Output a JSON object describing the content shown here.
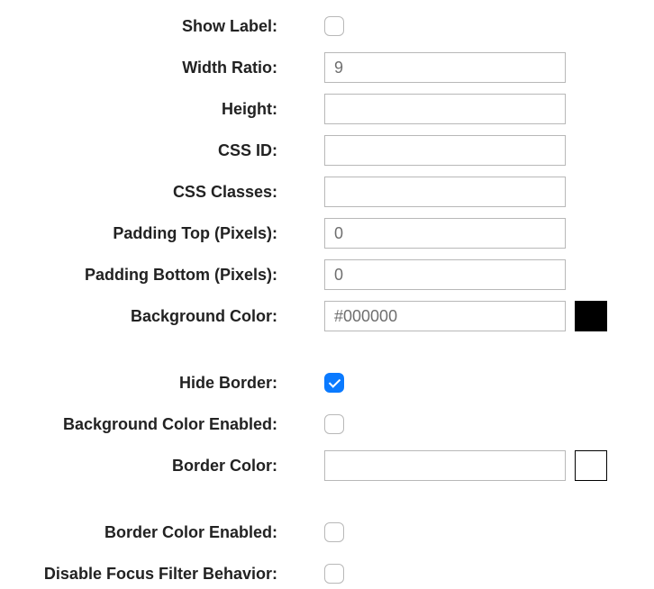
{
  "fields": {
    "show_label": {
      "label": "Show Label:",
      "checked": false
    },
    "width_ratio": {
      "label": "Width Ratio:",
      "value": "9"
    },
    "height": {
      "label": "Height:",
      "value": ""
    },
    "css_id": {
      "label": "CSS ID:",
      "value": ""
    },
    "css_classes": {
      "label": "CSS Classes:",
      "value": ""
    },
    "padding_top": {
      "label": "Padding Top (Pixels):",
      "value": "0"
    },
    "padding_bottom": {
      "label": "Padding Bottom (Pixels):",
      "value": "0"
    },
    "background_color": {
      "label": "Background Color:",
      "value": "#000000",
      "swatch": "#000000"
    },
    "hide_border": {
      "label": "Hide Border:",
      "checked": true
    },
    "background_color_enabled": {
      "label": "Background Color Enabled:",
      "checked": false
    },
    "border_color": {
      "label": "Border Color:",
      "value": "",
      "swatch": "#ffffff"
    },
    "border_color_enabled": {
      "label": "Border Color Enabled:",
      "checked": false
    },
    "disable_focus_filter": {
      "label": "Disable Focus Filter Behavior:",
      "checked": false
    }
  }
}
